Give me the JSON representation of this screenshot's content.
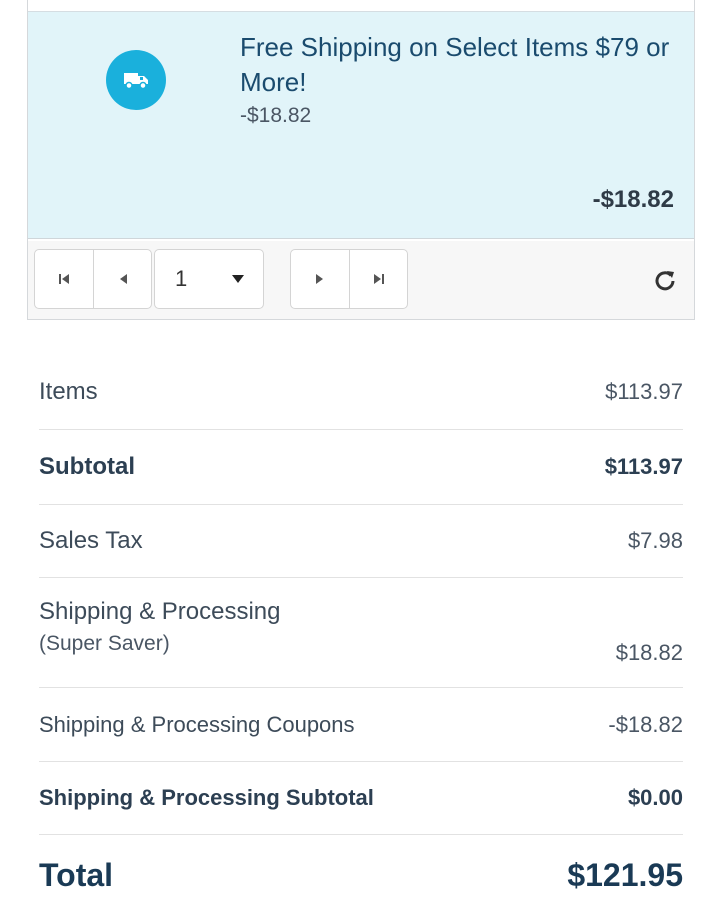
{
  "promo": {
    "icon": "truck-icon",
    "title": "Free Shipping on Select Items $79 or More!",
    "discount": "-$18.82",
    "amount": "-$18.82",
    "accent_color": "#1ab0dc",
    "background_color": "#e1f4f9"
  },
  "pager": {
    "first_icon": "first-page-icon",
    "prev_icon": "prev-page-icon",
    "page": "1",
    "next_icon": "next-page-icon",
    "last_icon": "last-page-icon",
    "refresh_icon": "refresh-icon"
  },
  "summary": {
    "items": {
      "label": "Items",
      "value": "$113.97"
    },
    "subtotal": {
      "label": "Subtotal",
      "value": "$113.97"
    },
    "sales_tax": {
      "label": "Sales Tax",
      "value": "$7.98"
    },
    "shipping": {
      "label": "Shipping & Processing",
      "note": "(Super Saver)",
      "value": "$18.82"
    },
    "shipping_coupons": {
      "label": "Shipping & Processing Coupons",
      "value": "-$18.82"
    },
    "shipping_subtotal": {
      "label": "Shipping & Processing Subtotal",
      "value": "$0.00"
    },
    "total": {
      "label": "Total",
      "value": "$121.95"
    }
  }
}
